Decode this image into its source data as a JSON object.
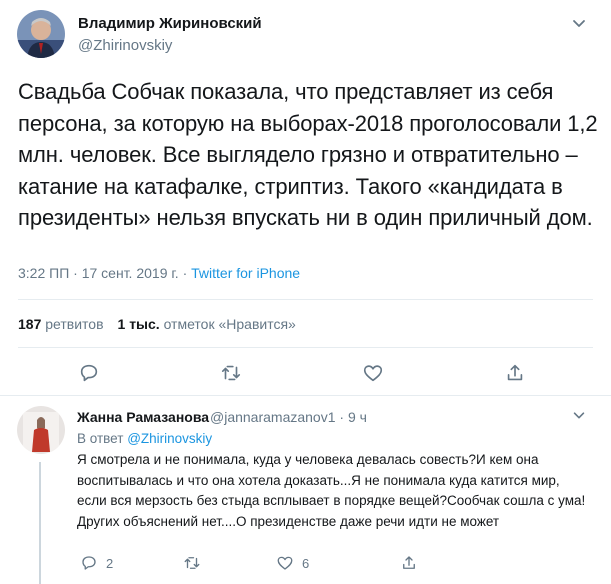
{
  "tweet": {
    "author_name": "Владимир Жириновский",
    "author_handle": "@Zhirinovskiy",
    "text": "Свадьба Собчак показала, что представляет из себя персона, за которую на выборах-2018 проголосовали 1,2 млн. человек. Все выглядело грязно и отвратительно – катание на катафалке, стриптиз. Такого «кандидата в президенты» нельзя впускать ни в один приличный дом.",
    "time": "3:22 ПП",
    "date": "17 сент. 2019 г.",
    "dot": "·",
    "source": "Twitter for iPhone",
    "retweets_count": "187",
    "retweets_label": "ретвитов",
    "likes_count": "1 тыс.",
    "likes_label": "отметок «Нравится»",
    "icons": [
      "reply-icon",
      "retweet-icon",
      "like-icon",
      "share-icon"
    ]
  },
  "reply": {
    "author_name": "Жанна Рамазанова",
    "author_handle": "@jannaramazanov1",
    "dot": "·",
    "time": "9 ч",
    "in_reply_label": "В ответ",
    "in_reply_to": "@Zhirinovskiy",
    "text": "Я смотрела и не понимала, куда у человека девалась совесть?И кем она воспитывалась и что она хотела доказать...Я не понимала куда катится мир, если вся мерзость без стыда всплывает в порядке вещей?Сообчак сошла с ума!Других объяснений нет....О президенстве даже речи идти не может",
    "reply_count": "2",
    "like_count": "6"
  },
  "colors": {
    "text": "#14171a",
    "secondary": "#657786",
    "link": "#1b95e0",
    "divider": "#e6ecf0",
    "thread_line": "#ccd6dd"
  }
}
